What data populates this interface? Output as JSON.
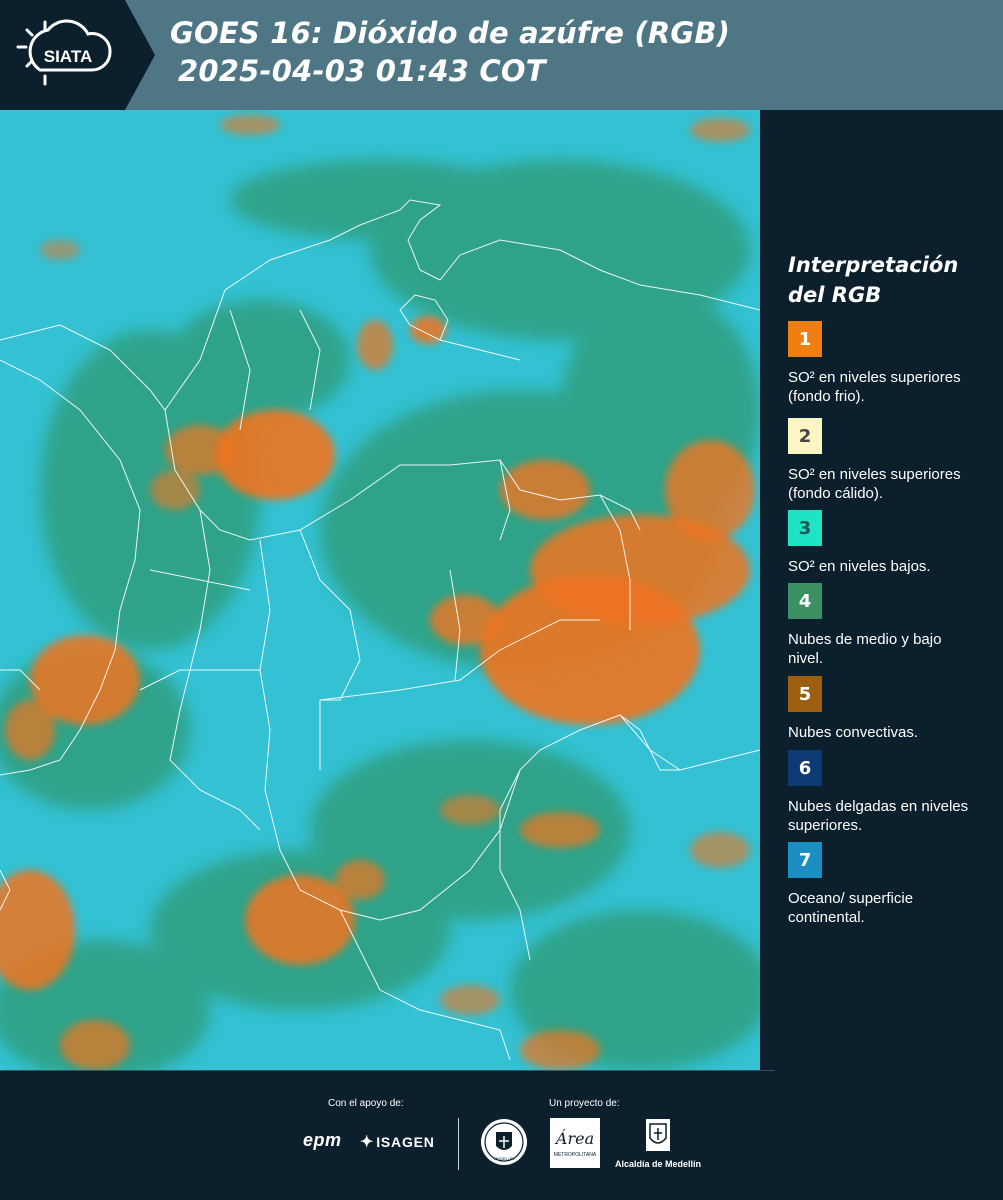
{
  "header": {
    "logo_text": "SIATA",
    "title_line1": "GOES 16: Dióxido de azúfre (RGB)",
    "title_line2": "2025-04-03 01:43 COT"
  },
  "legend": {
    "title_line1": "Interpretación",
    "title_line2": "del RGB",
    "items": [
      {
        "number": "1",
        "color": "#f07f12",
        "number_color": "#ffffff",
        "text": "SO² en niveles superiores (fondo frio)."
      },
      {
        "number": "2",
        "color": "#fcf6c4",
        "number_color": "#444444",
        "text": "SO² en niveles superiores (fondo cálido)."
      },
      {
        "number": "3",
        "color": "#1ee3c4",
        "number_color": "#1e5a52",
        "text": "SO² en niveles bajos."
      },
      {
        "number": "4",
        "color": "#3b8f63",
        "number_color": "#ffffff",
        "text": "Nubes de medio y bajo nivel."
      },
      {
        "number": "5",
        "color": "#9c5f10",
        "number_color": "#ffffff",
        "text": "Nubes convectivas."
      },
      {
        "number": "6",
        "color": "#0c3a73",
        "number_color": "#ffffff",
        "text": "Nubes delgadas en niveles superiores."
      },
      {
        "number": "7",
        "color": "#1b8fc4",
        "number_color": "#ffffff",
        "text": "Oceano/ superficie continental."
      }
    ]
  },
  "footer": {
    "support_label": "Con el apoyo de:",
    "project_label": "Un proyecto de:",
    "sponsors": {
      "epm": "epm",
      "isagen": "ISAGEN",
      "alcaldia": "Alcaldía de Medellín",
      "area_script": "Área",
      "area_caption": "METROPOLITANA",
      "seal_caption": "MEDELLÍN"
    }
  },
  "colors": {
    "header_bg": "#4e7685",
    "panel_bg": "#0c1f2d",
    "map_cyan": "#33c1d3",
    "map_green": "#2e9a72",
    "map_orange": "#f07420"
  },
  "icons": [
    "siata-sun-logo",
    "medellin-seal-icon",
    "area-metropolitana-logo",
    "alcaldia-crest-icon"
  ]
}
